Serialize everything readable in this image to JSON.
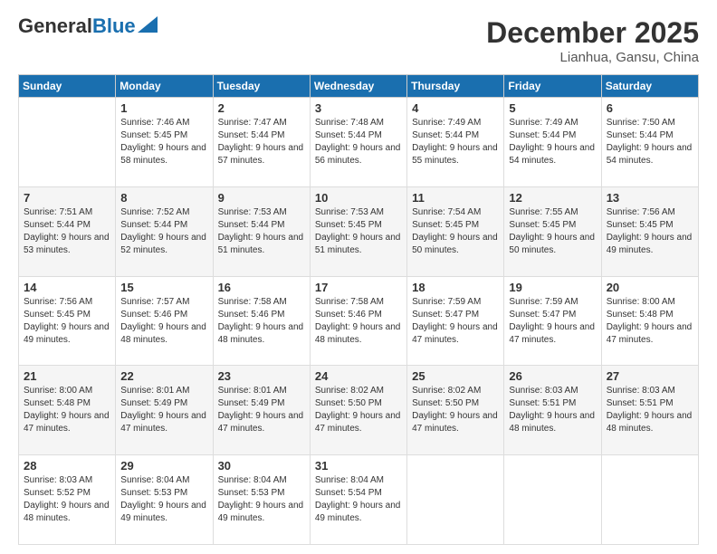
{
  "header": {
    "logo_general": "General",
    "logo_blue": "Blue",
    "month": "December 2025",
    "location": "Lianhua, Gansu, China"
  },
  "weekdays": [
    "Sunday",
    "Monday",
    "Tuesday",
    "Wednesday",
    "Thursday",
    "Friday",
    "Saturday"
  ],
  "weeks": [
    [
      {
        "day": "",
        "sunrise": "",
        "sunset": "",
        "daylight": ""
      },
      {
        "day": "1",
        "sunrise": "Sunrise: 7:46 AM",
        "sunset": "Sunset: 5:45 PM",
        "daylight": "Daylight: 9 hours and 58 minutes."
      },
      {
        "day": "2",
        "sunrise": "Sunrise: 7:47 AM",
        "sunset": "Sunset: 5:44 PM",
        "daylight": "Daylight: 9 hours and 57 minutes."
      },
      {
        "day": "3",
        "sunrise": "Sunrise: 7:48 AM",
        "sunset": "Sunset: 5:44 PM",
        "daylight": "Daylight: 9 hours and 56 minutes."
      },
      {
        "day": "4",
        "sunrise": "Sunrise: 7:49 AM",
        "sunset": "Sunset: 5:44 PM",
        "daylight": "Daylight: 9 hours and 55 minutes."
      },
      {
        "day": "5",
        "sunrise": "Sunrise: 7:49 AM",
        "sunset": "Sunset: 5:44 PM",
        "daylight": "Daylight: 9 hours and 54 minutes."
      },
      {
        "day": "6",
        "sunrise": "Sunrise: 7:50 AM",
        "sunset": "Sunset: 5:44 PM",
        "daylight": "Daylight: 9 hours and 54 minutes."
      }
    ],
    [
      {
        "day": "7",
        "sunrise": "Sunrise: 7:51 AM",
        "sunset": "Sunset: 5:44 PM",
        "daylight": "Daylight: 9 hours and 53 minutes."
      },
      {
        "day": "8",
        "sunrise": "Sunrise: 7:52 AM",
        "sunset": "Sunset: 5:44 PM",
        "daylight": "Daylight: 9 hours and 52 minutes."
      },
      {
        "day": "9",
        "sunrise": "Sunrise: 7:53 AM",
        "sunset": "Sunset: 5:44 PM",
        "daylight": "Daylight: 9 hours and 51 minutes."
      },
      {
        "day": "10",
        "sunrise": "Sunrise: 7:53 AM",
        "sunset": "Sunset: 5:45 PM",
        "daylight": "Daylight: 9 hours and 51 minutes."
      },
      {
        "day": "11",
        "sunrise": "Sunrise: 7:54 AM",
        "sunset": "Sunset: 5:45 PM",
        "daylight": "Daylight: 9 hours and 50 minutes."
      },
      {
        "day": "12",
        "sunrise": "Sunrise: 7:55 AM",
        "sunset": "Sunset: 5:45 PM",
        "daylight": "Daylight: 9 hours and 50 minutes."
      },
      {
        "day": "13",
        "sunrise": "Sunrise: 7:56 AM",
        "sunset": "Sunset: 5:45 PM",
        "daylight": "Daylight: 9 hours and 49 minutes."
      }
    ],
    [
      {
        "day": "14",
        "sunrise": "Sunrise: 7:56 AM",
        "sunset": "Sunset: 5:45 PM",
        "daylight": "Daylight: 9 hours and 49 minutes."
      },
      {
        "day": "15",
        "sunrise": "Sunrise: 7:57 AM",
        "sunset": "Sunset: 5:46 PM",
        "daylight": "Daylight: 9 hours and 48 minutes."
      },
      {
        "day": "16",
        "sunrise": "Sunrise: 7:58 AM",
        "sunset": "Sunset: 5:46 PM",
        "daylight": "Daylight: 9 hours and 48 minutes."
      },
      {
        "day": "17",
        "sunrise": "Sunrise: 7:58 AM",
        "sunset": "Sunset: 5:46 PM",
        "daylight": "Daylight: 9 hours and 48 minutes."
      },
      {
        "day": "18",
        "sunrise": "Sunrise: 7:59 AM",
        "sunset": "Sunset: 5:47 PM",
        "daylight": "Daylight: 9 hours and 47 minutes."
      },
      {
        "day": "19",
        "sunrise": "Sunrise: 7:59 AM",
        "sunset": "Sunset: 5:47 PM",
        "daylight": "Daylight: 9 hours and 47 minutes."
      },
      {
        "day": "20",
        "sunrise": "Sunrise: 8:00 AM",
        "sunset": "Sunset: 5:48 PM",
        "daylight": "Daylight: 9 hours and 47 minutes."
      }
    ],
    [
      {
        "day": "21",
        "sunrise": "Sunrise: 8:00 AM",
        "sunset": "Sunset: 5:48 PM",
        "daylight": "Daylight: 9 hours and 47 minutes."
      },
      {
        "day": "22",
        "sunrise": "Sunrise: 8:01 AM",
        "sunset": "Sunset: 5:49 PM",
        "daylight": "Daylight: 9 hours and 47 minutes."
      },
      {
        "day": "23",
        "sunrise": "Sunrise: 8:01 AM",
        "sunset": "Sunset: 5:49 PM",
        "daylight": "Daylight: 9 hours and 47 minutes."
      },
      {
        "day": "24",
        "sunrise": "Sunrise: 8:02 AM",
        "sunset": "Sunset: 5:50 PM",
        "daylight": "Daylight: 9 hours and 47 minutes."
      },
      {
        "day": "25",
        "sunrise": "Sunrise: 8:02 AM",
        "sunset": "Sunset: 5:50 PM",
        "daylight": "Daylight: 9 hours and 47 minutes."
      },
      {
        "day": "26",
        "sunrise": "Sunrise: 8:03 AM",
        "sunset": "Sunset: 5:51 PM",
        "daylight": "Daylight: 9 hours and 48 minutes."
      },
      {
        "day": "27",
        "sunrise": "Sunrise: 8:03 AM",
        "sunset": "Sunset: 5:51 PM",
        "daylight": "Daylight: 9 hours and 48 minutes."
      }
    ],
    [
      {
        "day": "28",
        "sunrise": "Sunrise: 8:03 AM",
        "sunset": "Sunset: 5:52 PM",
        "daylight": "Daylight: 9 hours and 48 minutes."
      },
      {
        "day": "29",
        "sunrise": "Sunrise: 8:04 AM",
        "sunset": "Sunset: 5:53 PM",
        "daylight": "Daylight: 9 hours and 49 minutes."
      },
      {
        "day": "30",
        "sunrise": "Sunrise: 8:04 AM",
        "sunset": "Sunset: 5:53 PM",
        "daylight": "Daylight: 9 hours and 49 minutes."
      },
      {
        "day": "31",
        "sunrise": "Sunrise: 8:04 AM",
        "sunset": "Sunset: 5:54 PM",
        "daylight": "Daylight: 9 hours and 49 minutes."
      },
      {
        "day": "",
        "sunrise": "",
        "sunset": "",
        "daylight": ""
      },
      {
        "day": "",
        "sunrise": "",
        "sunset": "",
        "daylight": ""
      },
      {
        "day": "",
        "sunrise": "",
        "sunset": "",
        "daylight": ""
      }
    ]
  ]
}
